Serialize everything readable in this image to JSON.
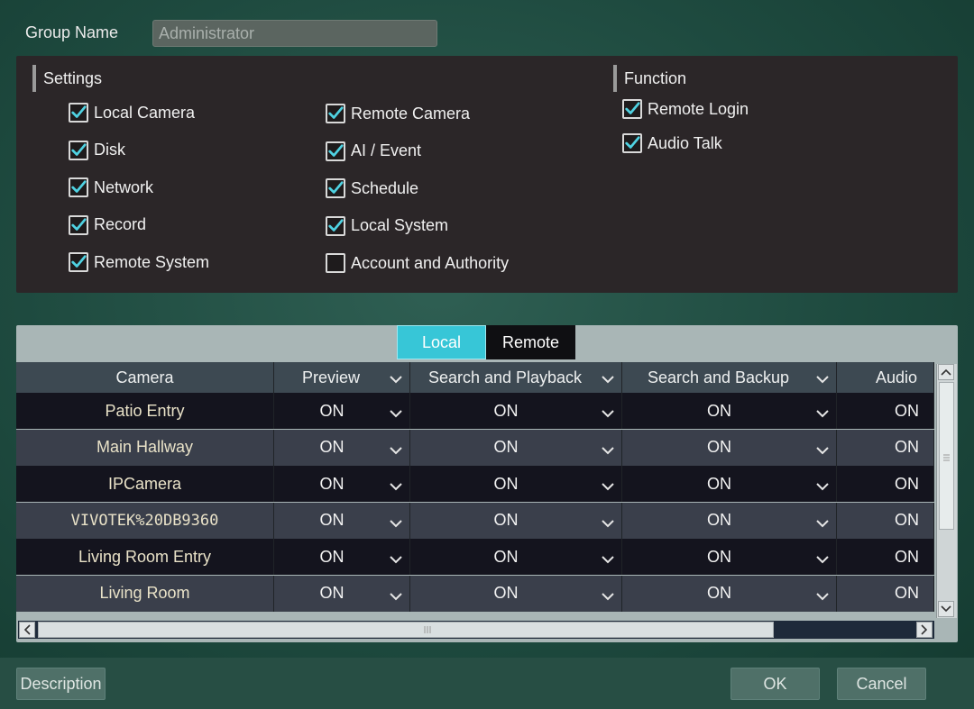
{
  "group": {
    "label": "Group Name",
    "value": "Administrator"
  },
  "settings": {
    "title": "Settings",
    "col1": [
      {
        "label": "Local Camera",
        "checked": true
      },
      {
        "label": "Disk",
        "checked": true
      },
      {
        "label": "Network",
        "checked": true
      },
      {
        "label": "Record",
        "checked": true
      },
      {
        "label": "Remote System",
        "checked": true
      }
    ],
    "col2": [
      {
        "label": "Remote Camera",
        "checked": true
      },
      {
        "label": "AI / Event",
        "checked": true
      },
      {
        "label": "Schedule",
        "checked": true
      },
      {
        "label": "Local System",
        "checked": true
      },
      {
        "label": "Account and Authority",
        "checked": false
      }
    ]
  },
  "function": {
    "title": "Function",
    "items": [
      {
        "label": "Remote Login",
        "checked": true
      },
      {
        "label": "Audio Talk",
        "checked": true
      }
    ]
  },
  "tabs": {
    "local": "Local",
    "remote": "Remote",
    "active": "local"
  },
  "table": {
    "headers": [
      "Camera",
      "Preview",
      "Search and Playback",
      "Search and Backup",
      "Audio"
    ],
    "rows": [
      {
        "camera": "Patio Entry",
        "preview": "ON",
        "playback": "ON",
        "backup": "ON",
        "audio": "ON"
      },
      {
        "camera": "Main Hallway",
        "preview": "ON",
        "playback": "ON",
        "backup": "ON",
        "audio": "ON"
      },
      {
        "camera": "IPCamera",
        "preview": "ON",
        "playback": "ON",
        "backup": "ON",
        "audio": "ON"
      },
      {
        "camera": "VIVOTEK%20DB9360",
        "preview": "ON",
        "playback": "ON",
        "backup": "ON",
        "audio": "ON"
      },
      {
        "camera": "Living Room Entry",
        "preview": "ON",
        "playback": "ON",
        "backup": "ON",
        "audio": "ON"
      },
      {
        "camera": "Living Room",
        "preview": "ON",
        "playback": "ON",
        "backup": "ON",
        "audio": "ON"
      }
    ]
  },
  "buttons": {
    "description": "Description",
    "ok": "OK",
    "cancel": "Cancel"
  },
  "icons": {
    "checkbox": "checkmark-icon",
    "dropdown": "chevron-down-icon"
  },
  "colors": {
    "accent": "#37c6d7",
    "check": "#4fd2e2"
  }
}
